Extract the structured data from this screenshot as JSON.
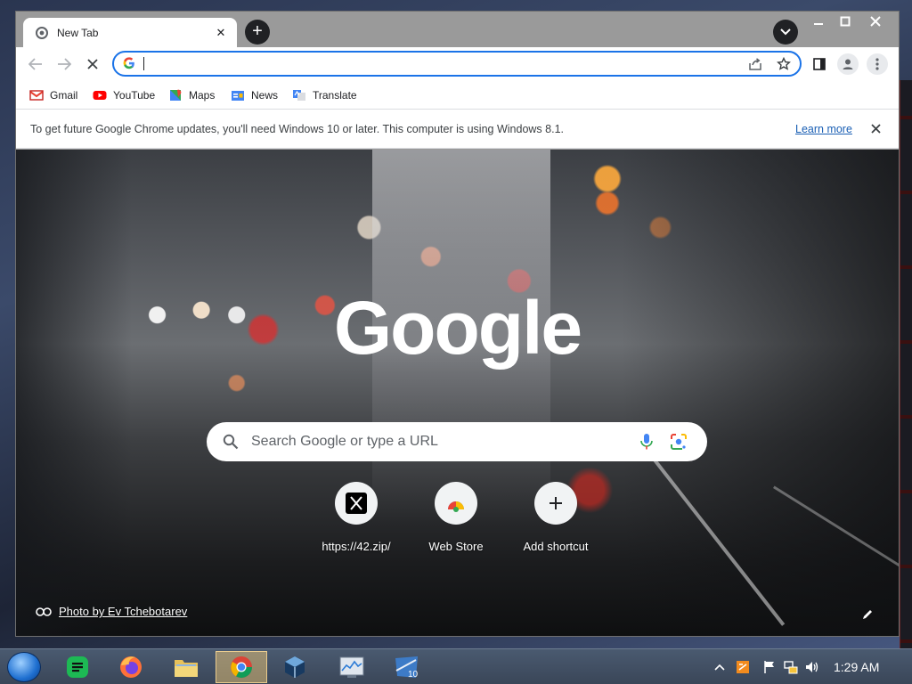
{
  "browser": {
    "tab": {
      "title": "New Tab"
    },
    "toolbar": {
      "omnibox_value": ""
    },
    "bookmarks": [
      {
        "label": "Gmail",
        "icon": "gmail-icon"
      },
      {
        "label": "YouTube",
        "icon": "youtube-icon"
      },
      {
        "label": "Maps",
        "icon": "maps-icon"
      },
      {
        "label": "News",
        "icon": "news-icon"
      },
      {
        "label": "Translate",
        "icon": "translate-icon"
      }
    ],
    "infobar": {
      "message": "To get future Google Chrome updates, you'll need Windows 10 or later. This computer is using Windows 8.1.",
      "link": "Learn more"
    }
  },
  "ntp": {
    "logo": "Google",
    "search_placeholder": "Search Google or type a URL",
    "shortcuts": [
      {
        "label": "https://42.zip/",
        "icon": "x-logo-icon"
      },
      {
        "label": "Web Store",
        "icon": "chrome-web-store-icon"
      },
      {
        "label": "Add shortcut",
        "icon": "plus-icon"
      }
    ],
    "photo_credit": "Photo by Ev Tchebotarev"
  },
  "taskbar": {
    "apps": [
      "start-orb",
      "notes-app",
      "firefox",
      "file-explorer",
      "chrome",
      "virtualbox",
      "resource-monitor",
      "windows-10-tool"
    ],
    "active_app": "chrome",
    "clock": "1:29 AM"
  },
  "colors": {
    "omnibox_focus": "#1a73e8",
    "link": "#1a5fb4",
    "titlebar": "#9a9a9a"
  }
}
